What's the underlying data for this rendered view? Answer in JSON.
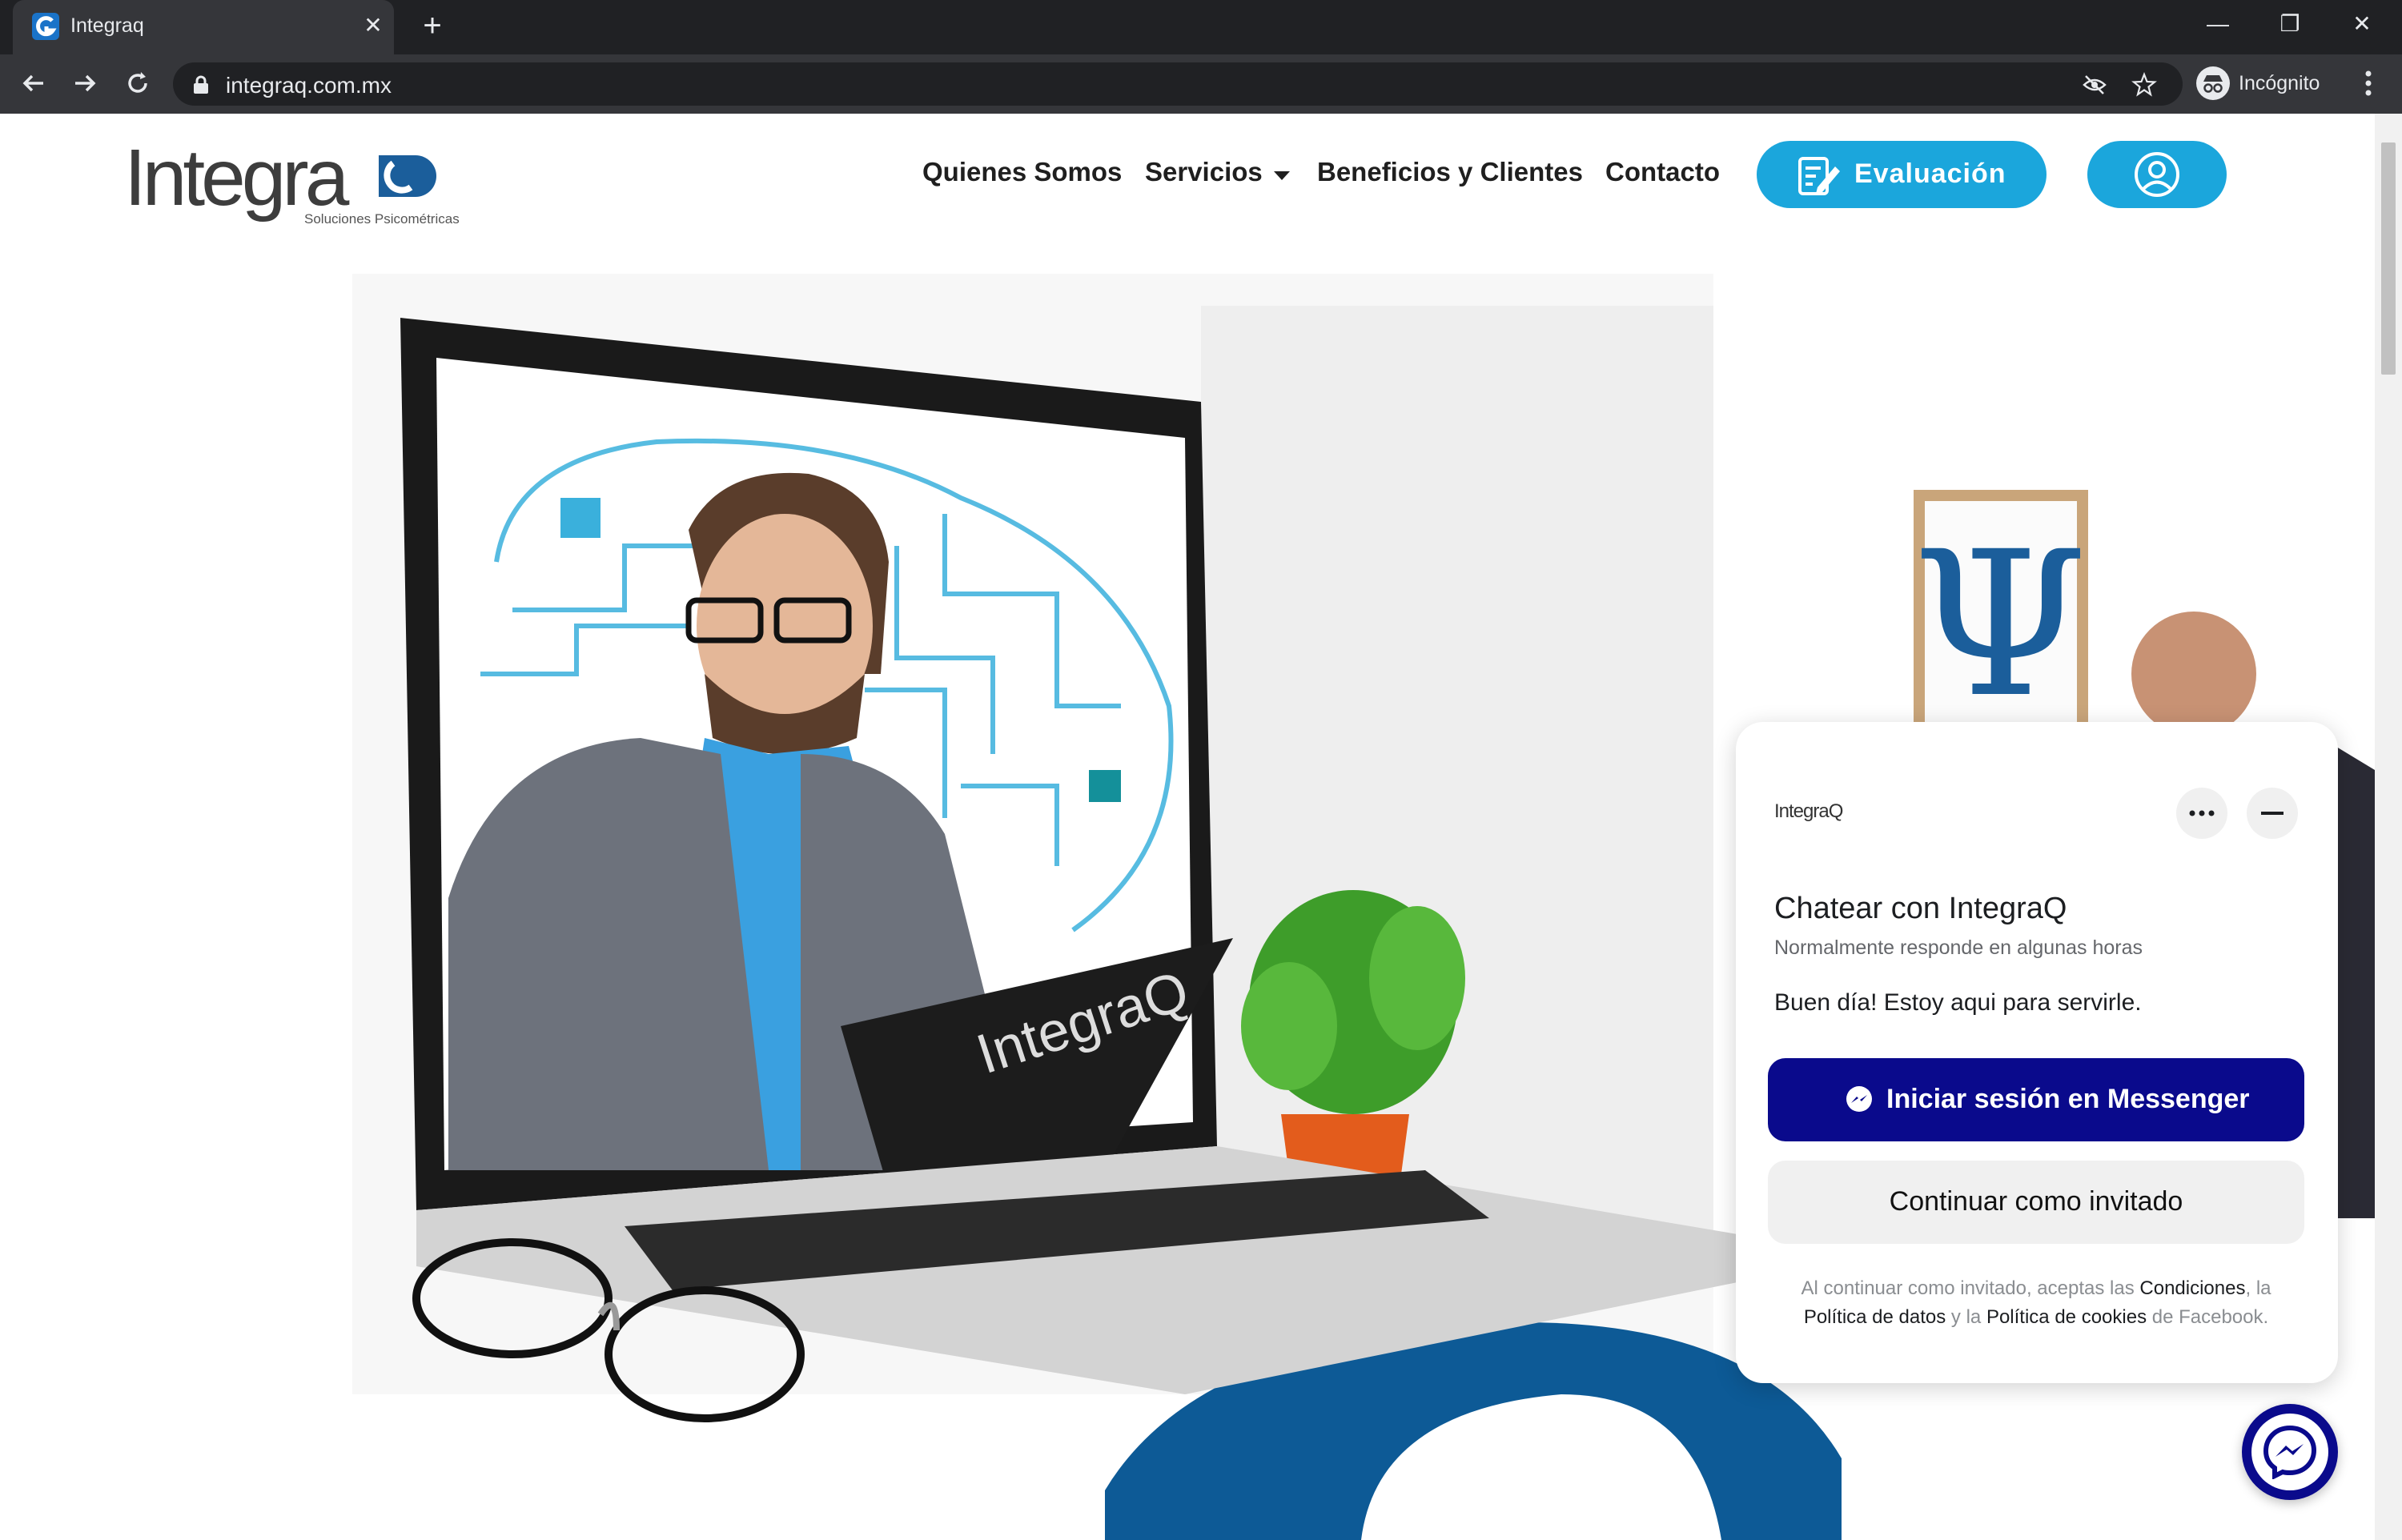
{
  "browser": {
    "tab_title": "Integraq",
    "tab_close": "✕",
    "new_tab": "+",
    "url": "integraq.com.mx",
    "profile_label": "Incógnito",
    "window_controls": [
      "—",
      "❐",
      "✕"
    ]
  },
  "site": {
    "logo_text": "IntegraQ",
    "logo_subtitle": "Soluciones Psicométricas",
    "nav": {
      "quienes": "Quienes Somos",
      "servicios": "Servicios",
      "beneficios": "Beneficios y Clientes",
      "contacto": "Contacto",
      "evaluacion": "Evaluación"
    },
    "clipboard_text": "IntegraQ",
    "psi_symbol": "Ψ"
  },
  "chat": {
    "logo_text": "IntegraQ",
    "title": "Chatear con IntegraQ",
    "subtitle": "Normalmente responde en algunas horas",
    "message": "Buen día! Estoy aqui para servirle.",
    "messenger_button": "Iniciar sesión en Messenger",
    "guest_button": "Continuar como invitado",
    "legal": {
      "p1": "Al continuar como invitado, aceptas las ",
      "link1": "Condiciones",
      "p2": ", la ",
      "link2": "Política de datos",
      "p3": " y la ",
      "link3": "Política de cookies",
      "p4": " de Facebook."
    }
  },
  "colors": {
    "brand_blue": "#1ba6dc",
    "messenger_navy": "#0a0a8c",
    "chrome_dark": "#202124",
    "chrome_mid": "#35363a"
  }
}
